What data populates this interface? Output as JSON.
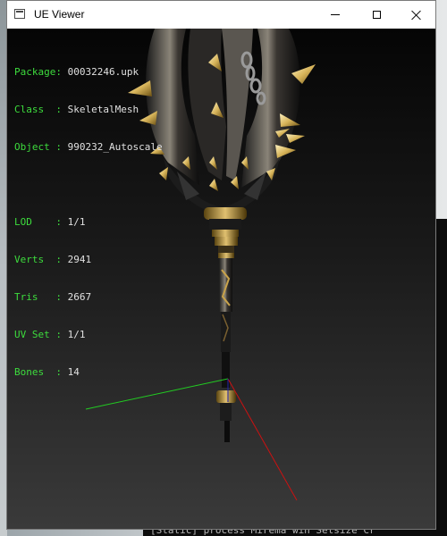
{
  "window": {
    "title": "UE Viewer"
  },
  "info": {
    "package_key": "Package: ",
    "package_val": "00032246.upk",
    "class_key": "Class  : ",
    "class_val": "SkeletalMesh",
    "object_key": "Object : ",
    "object_val": "990232_Autoscale",
    "lod_key": "LOD    : ",
    "lod_val": "1/1",
    "verts_key": "Verts  : ",
    "verts_val": "2941",
    "tris_key": "Tris   : ",
    "tris_val": "2667",
    "uvset_key": "UV Set : ",
    "uvset_val": "1/1",
    "bones_key": "Bones  : ",
    "bones_val": "14"
  },
  "background_console": {
    "bottom_text": "[Static] process  Mirema win Setsize  Cr"
  },
  "colors": {
    "label_green": "#3ddc3d",
    "value_white": "#e0e0e0",
    "axis_green": "#22cc22",
    "axis_red": "#cc1111",
    "gold": "#c9a34a"
  }
}
